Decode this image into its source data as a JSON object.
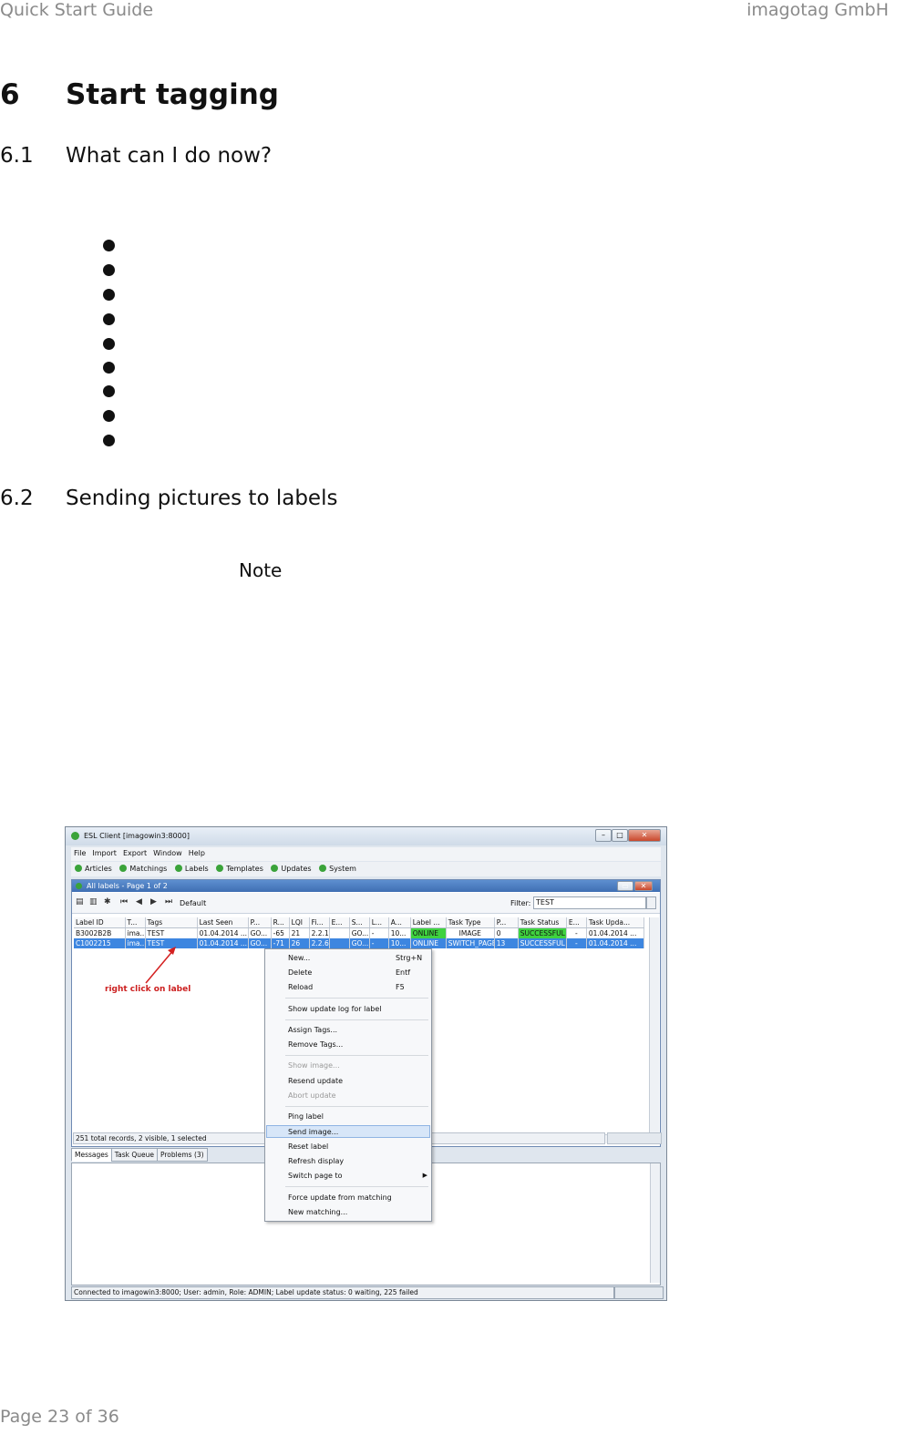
{
  "header": {
    "left": "Quick Start Guide",
    "right": "imagotag GmbH"
  },
  "section": {
    "number": "6",
    "title": "Start tagging"
  },
  "subsections": [
    {
      "number": "6.1",
      "title": "What can I do now?"
    },
    {
      "number": "6.2",
      "title": "Sending pictures to labels"
    }
  ],
  "note_label": "Note",
  "footer": {
    "page": "Page 23 of 36"
  },
  "screenshot": {
    "window_title": "ESL Client [imagowin3:8000]",
    "menu": [
      "File",
      "Import",
      "Export",
      "Window",
      "Help"
    ],
    "nav": [
      "Articles",
      "Matchings",
      "Labels",
      "Templates",
      "Updates",
      "System"
    ],
    "panel_title": "All labels - Page 1 of 2",
    "profile": "Default",
    "filter_label": "Filter:",
    "filter_value": "TEST",
    "columns": [
      "Label ID",
      "T...",
      "Tags",
      "Last Seen",
      "P...",
      "R...",
      "LQI",
      "Fi...",
      "E...",
      "S...",
      "L...",
      "A...",
      "Label ...",
      "Task Type",
      "P...",
      "Task Status",
      "E...",
      "Task Upda..."
    ],
    "rows": [
      [
        "B3002B2B",
        "ima...",
        "TEST",
        "01.04.2014 ...",
        "GO...",
        "-65",
        "21",
        "2.2.1",
        "",
        "GO...",
        "-",
        "10...",
        "ONLINE",
        "IMAGE",
        "0",
        "SUCCESSFUL",
        "-",
        "01.04.2014 ..."
      ],
      [
        "C1002215",
        "ima...",
        "TEST",
        "01.04.2014 ...",
        "GO...",
        "-71",
        "26",
        "2.2.6",
        "",
        "GO...",
        "-",
        "10...",
        "ONLINE",
        "SWITCH_PAGE",
        "13",
        "SUCCESSFUL",
        "-",
        "01.04.2014 ..."
      ]
    ],
    "status_text": "251 total records, 2 visible, 1 selected",
    "bottom_tabs": [
      "Messages",
      "Task Queue",
      "Problems (3)"
    ],
    "connection_status": "Connected to imagowin3:8000; User: admin, Role: ADMIN; Label update status: 0 waiting, 225 failed",
    "annotation": "right click on  label",
    "context_menu": {
      "new": "New...",
      "new_sc": "Strg+N",
      "delete": "Delete",
      "delete_sc": "Entf",
      "reload": "Reload",
      "reload_sc": "F5",
      "show_log": "Show update log for label",
      "assign_tags": "Assign Tags...",
      "remove_tags": "Remove Tags...",
      "show_image": "Show image...",
      "resend": "Resend update",
      "abort": "Abort update",
      "ping": "Ping label",
      "send_image": "Send image...",
      "reset": "Reset label",
      "refresh": "Refresh display",
      "switch_page": "Switch page to",
      "force_update": "Force update from matching",
      "new_matching": "New matching..."
    }
  }
}
